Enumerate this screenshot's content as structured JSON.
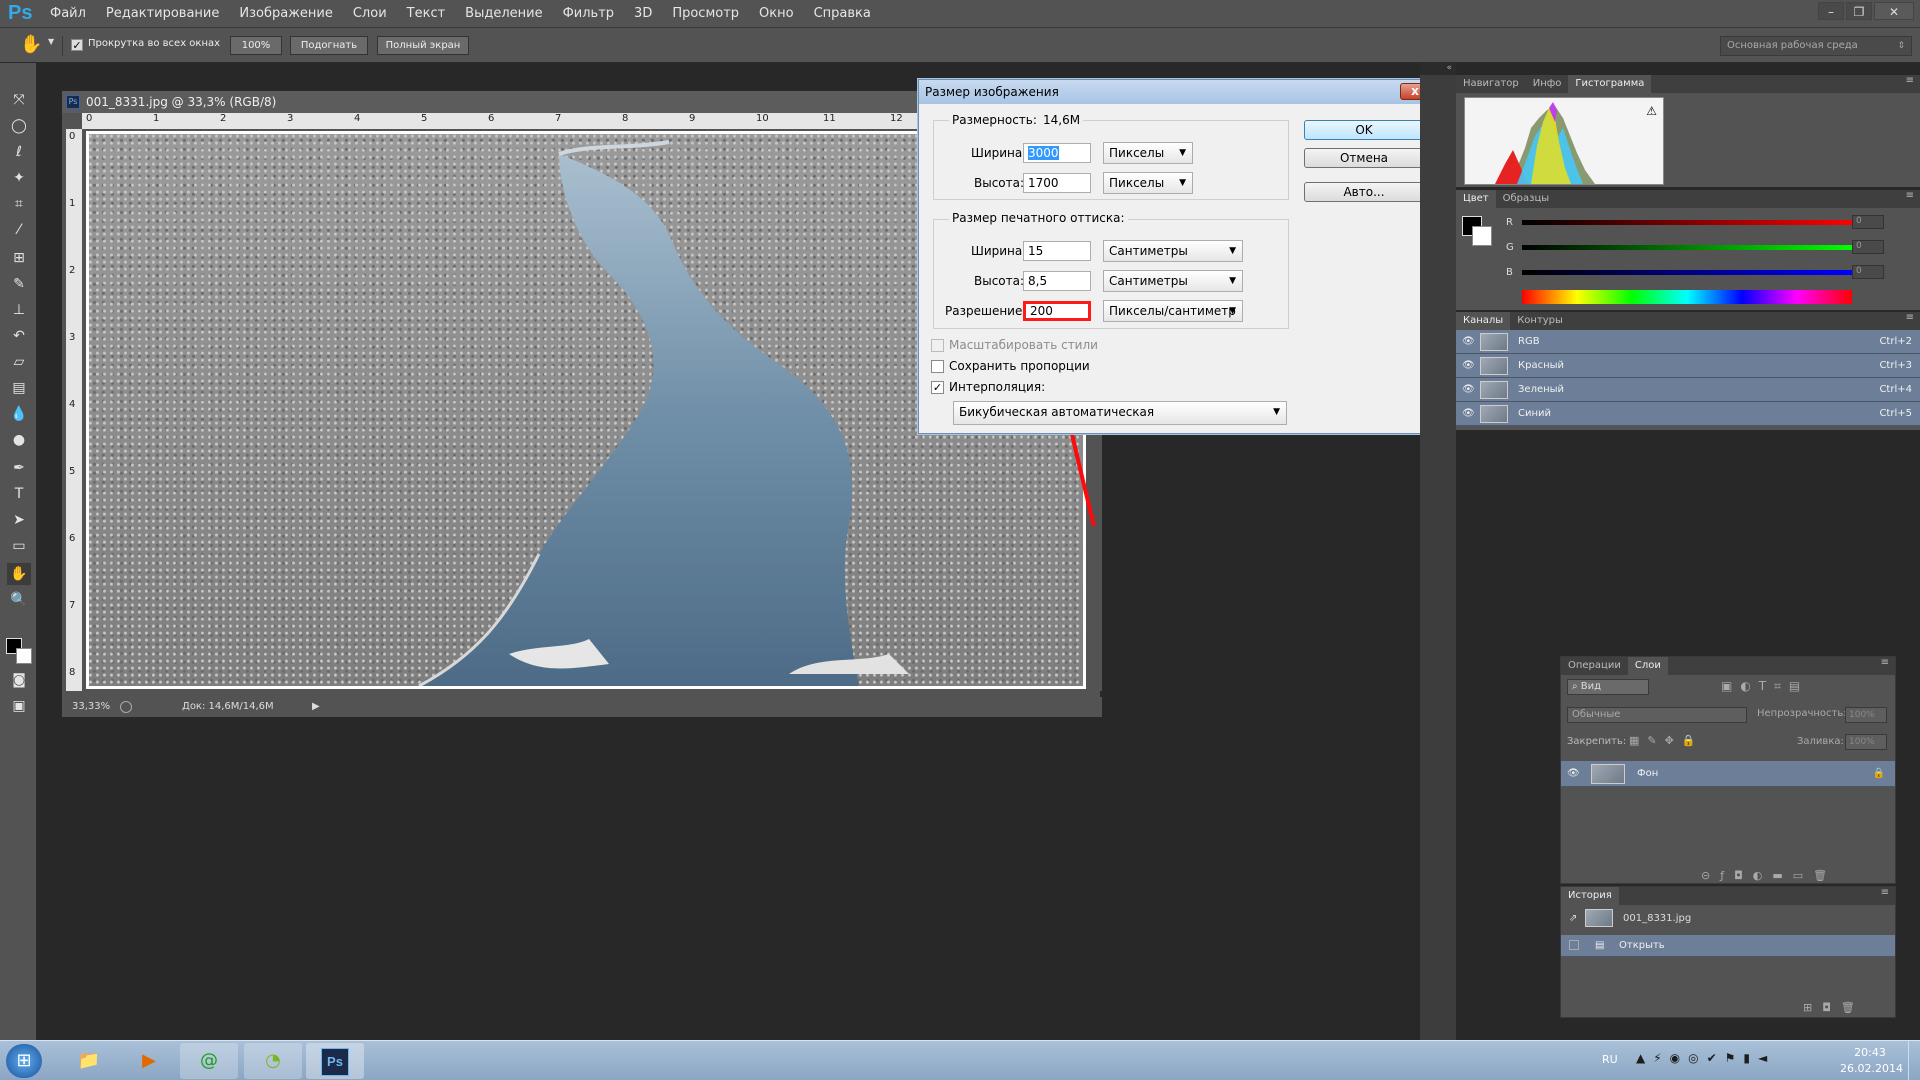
{
  "menubar": {
    "logo": "Ps",
    "items": [
      "Файл",
      "Редактирование",
      "Изображение",
      "Слои",
      "Текст",
      "Выделение",
      "Фильтр",
      "3D",
      "Просмотр",
      "Окно",
      "Справка"
    ]
  },
  "options": {
    "scroll_all_label": "Прокрутка во всех окнах",
    "btn_100": "100%",
    "btn_fit": "Подогнать",
    "btn_full": "Полный экран",
    "workspace": "Основная рабочая среда"
  },
  "document": {
    "tab_title": "001_8331.jpg @ 33,3% (RGB/8)",
    "zoom": "33,33%",
    "doc_size": "Док: 14,6M/14,6M",
    "ruler_top": [
      "0",
      "1",
      "2",
      "3",
      "4",
      "5",
      "6",
      "7",
      "8",
      "9",
      "10",
      "11",
      "12"
    ],
    "ruler_left": [
      "0",
      "1",
      "2",
      "3",
      "4",
      "5",
      "6",
      "7",
      "8"
    ]
  },
  "dialog": {
    "title": "Размер изображения",
    "close": "x",
    "pixel_group": {
      "dim_label": "Размерность:",
      "dim_value": "14,6M",
      "width_label": "Ширина:",
      "width_value": "3000",
      "width_unit": "Пикселы",
      "height_label": "Высота:",
      "height_value": "1700",
      "height_unit": "Пикселы"
    },
    "print_group": {
      "legend": "Размер печатного оттиска:",
      "width_label": "Ширина:",
      "width_value": "15",
      "width_unit": "Сантиметры",
      "height_label": "Высота:",
      "height_value": "8,5",
      "height_unit": "Сантиметры",
      "res_label": "Разрешение:",
      "res_value": "200",
      "res_unit": "Пикселы/сантиметр"
    },
    "scale_styles": "Масштабировать стили",
    "constrain": "Сохранить пропорции",
    "resample": "Интерполяция:",
    "resample_method": "Бикубическая автоматическая",
    "ok": "OK",
    "cancel": "Отмена",
    "auto": "Авто..."
  },
  "panels": {
    "nav_tabs": [
      "Навигатор",
      "Инфо",
      "Гистограмма"
    ],
    "color_tabs": [
      "Цвет",
      "Образцы"
    ],
    "color_labels": [
      "R",
      "G",
      "B"
    ],
    "color_values": [
      "0",
      "0",
      "0"
    ],
    "channel_tabs": [
      "Каналы",
      "Контуры"
    ],
    "channels": [
      {
        "name": "RGB",
        "key": "Ctrl+2"
      },
      {
        "name": "Красный",
        "key": "Ctrl+3"
      },
      {
        "name": "Зеленый",
        "key": "Ctrl+4"
      },
      {
        "name": "Синий",
        "key": "Ctrl+5"
      }
    ],
    "layers_tabs": [
      "Операции",
      "Слои"
    ],
    "layers": {
      "filter": "Вид",
      "blend": "Обычные",
      "opacity_label": "Непрозрачность:",
      "opacity": "100%",
      "lock_label": "Закрепить:",
      "fill_label": "Заливка:",
      "fill": "100%",
      "layer_name": "Фон"
    },
    "history_tab": "История",
    "history": {
      "snapshot": "001_8331.jpg",
      "step": "Открыть"
    }
  },
  "taskbar": {
    "lang": "RU",
    "time": "20:43",
    "date": "26.02.2014"
  },
  "colors": {
    "accent": "#34a9e8",
    "highlight": "#ff0000",
    "panel": "#535353"
  }
}
